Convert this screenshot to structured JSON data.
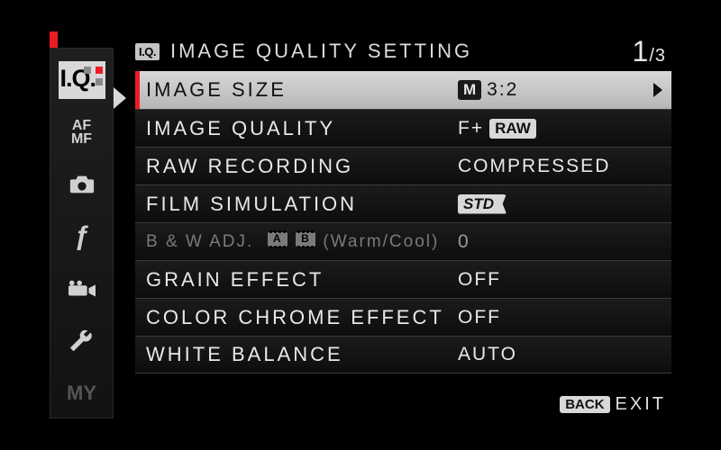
{
  "header": {
    "badge": "I.Q.",
    "title": "IMAGE QUALITY SETTING",
    "page_current": "1",
    "page_sep": "/",
    "page_total": "3"
  },
  "sidebar": {
    "items": [
      {
        "id": "iq",
        "label": "I.Q."
      },
      {
        "id": "afmf",
        "label_top": "AF",
        "label_bot": "MF"
      },
      {
        "id": "shoot"
      },
      {
        "id": "flash",
        "glyph": "ƒ"
      },
      {
        "id": "movie"
      },
      {
        "id": "setup"
      },
      {
        "id": "my",
        "label": "MY"
      }
    ]
  },
  "rows": [
    {
      "label": "IMAGE SIZE",
      "value_badge": "M",
      "value_text": "3:2",
      "selected": true,
      "arrow": true
    },
    {
      "label": "IMAGE QUALITY",
      "value_pre": "F+",
      "value_badge": "RAW"
    },
    {
      "label": "RAW RECORDING",
      "value_text": "COMPRESSED"
    },
    {
      "label": "FILM SIMULATION",
      "value_std": "STD"
    },
    {
      "label": "B & W ADJ.",
      "bw_a": "A",
      "bw_b": "B",
      "bw_note": "(Warm/Cool)",
      "value_text": "0",
      "disabled": true
    },
    {
      "label": "GRAIN EFFECT",
      "value_text": "OFF"
    },
    {
      "label": "COLOR CHROME EFFECT",
      "value_text": "OFF"
    },
    {
      "label": "WHITE BALANCE",
      "value_text": "AUTO"
    }
  ],
  "footer": {
    "back_badge": "BACK",
    "exit": "EXIT"
  }
}
